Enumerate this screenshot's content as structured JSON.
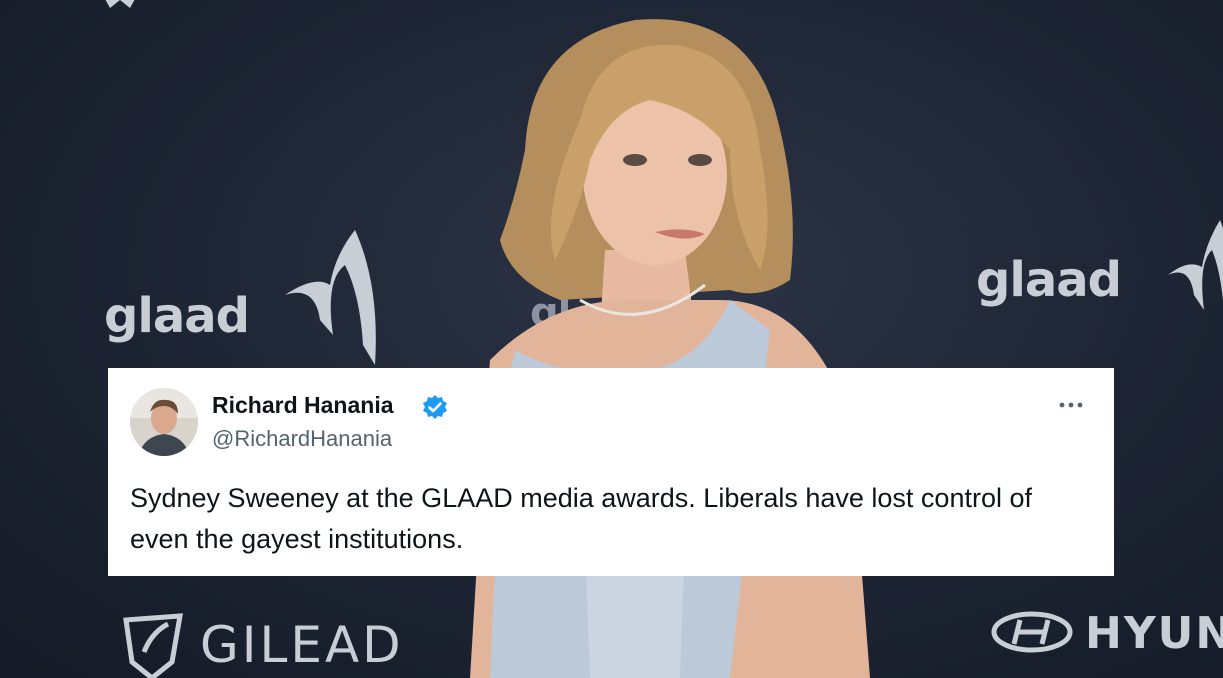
{
  "backdrop": {
    "logo_left": "glaad",
    "logo_mid": "gl",
    "logo_right": "glaad",
    "sponsor_left": "GILEAD",
    "sponsor_right": "HYUNI"
  },
  "tweet": {
    "author_name": "Richard Hanania",
    "author_handle": "@RichardHanania",
    "verified": true,
    "more_icon": "more-horizontal-icon",
    "text": "Sydney Sweeney at the GLAAD media awards. Liberals have lost control of even the gayest institutions."
  },
  "colors": {
    "card_bg": "#ffffff",
    "name_color": "#0f1419",
    "handle_color": "#536471",
    "verified_blue": "#1d9bf0"
  }
}
